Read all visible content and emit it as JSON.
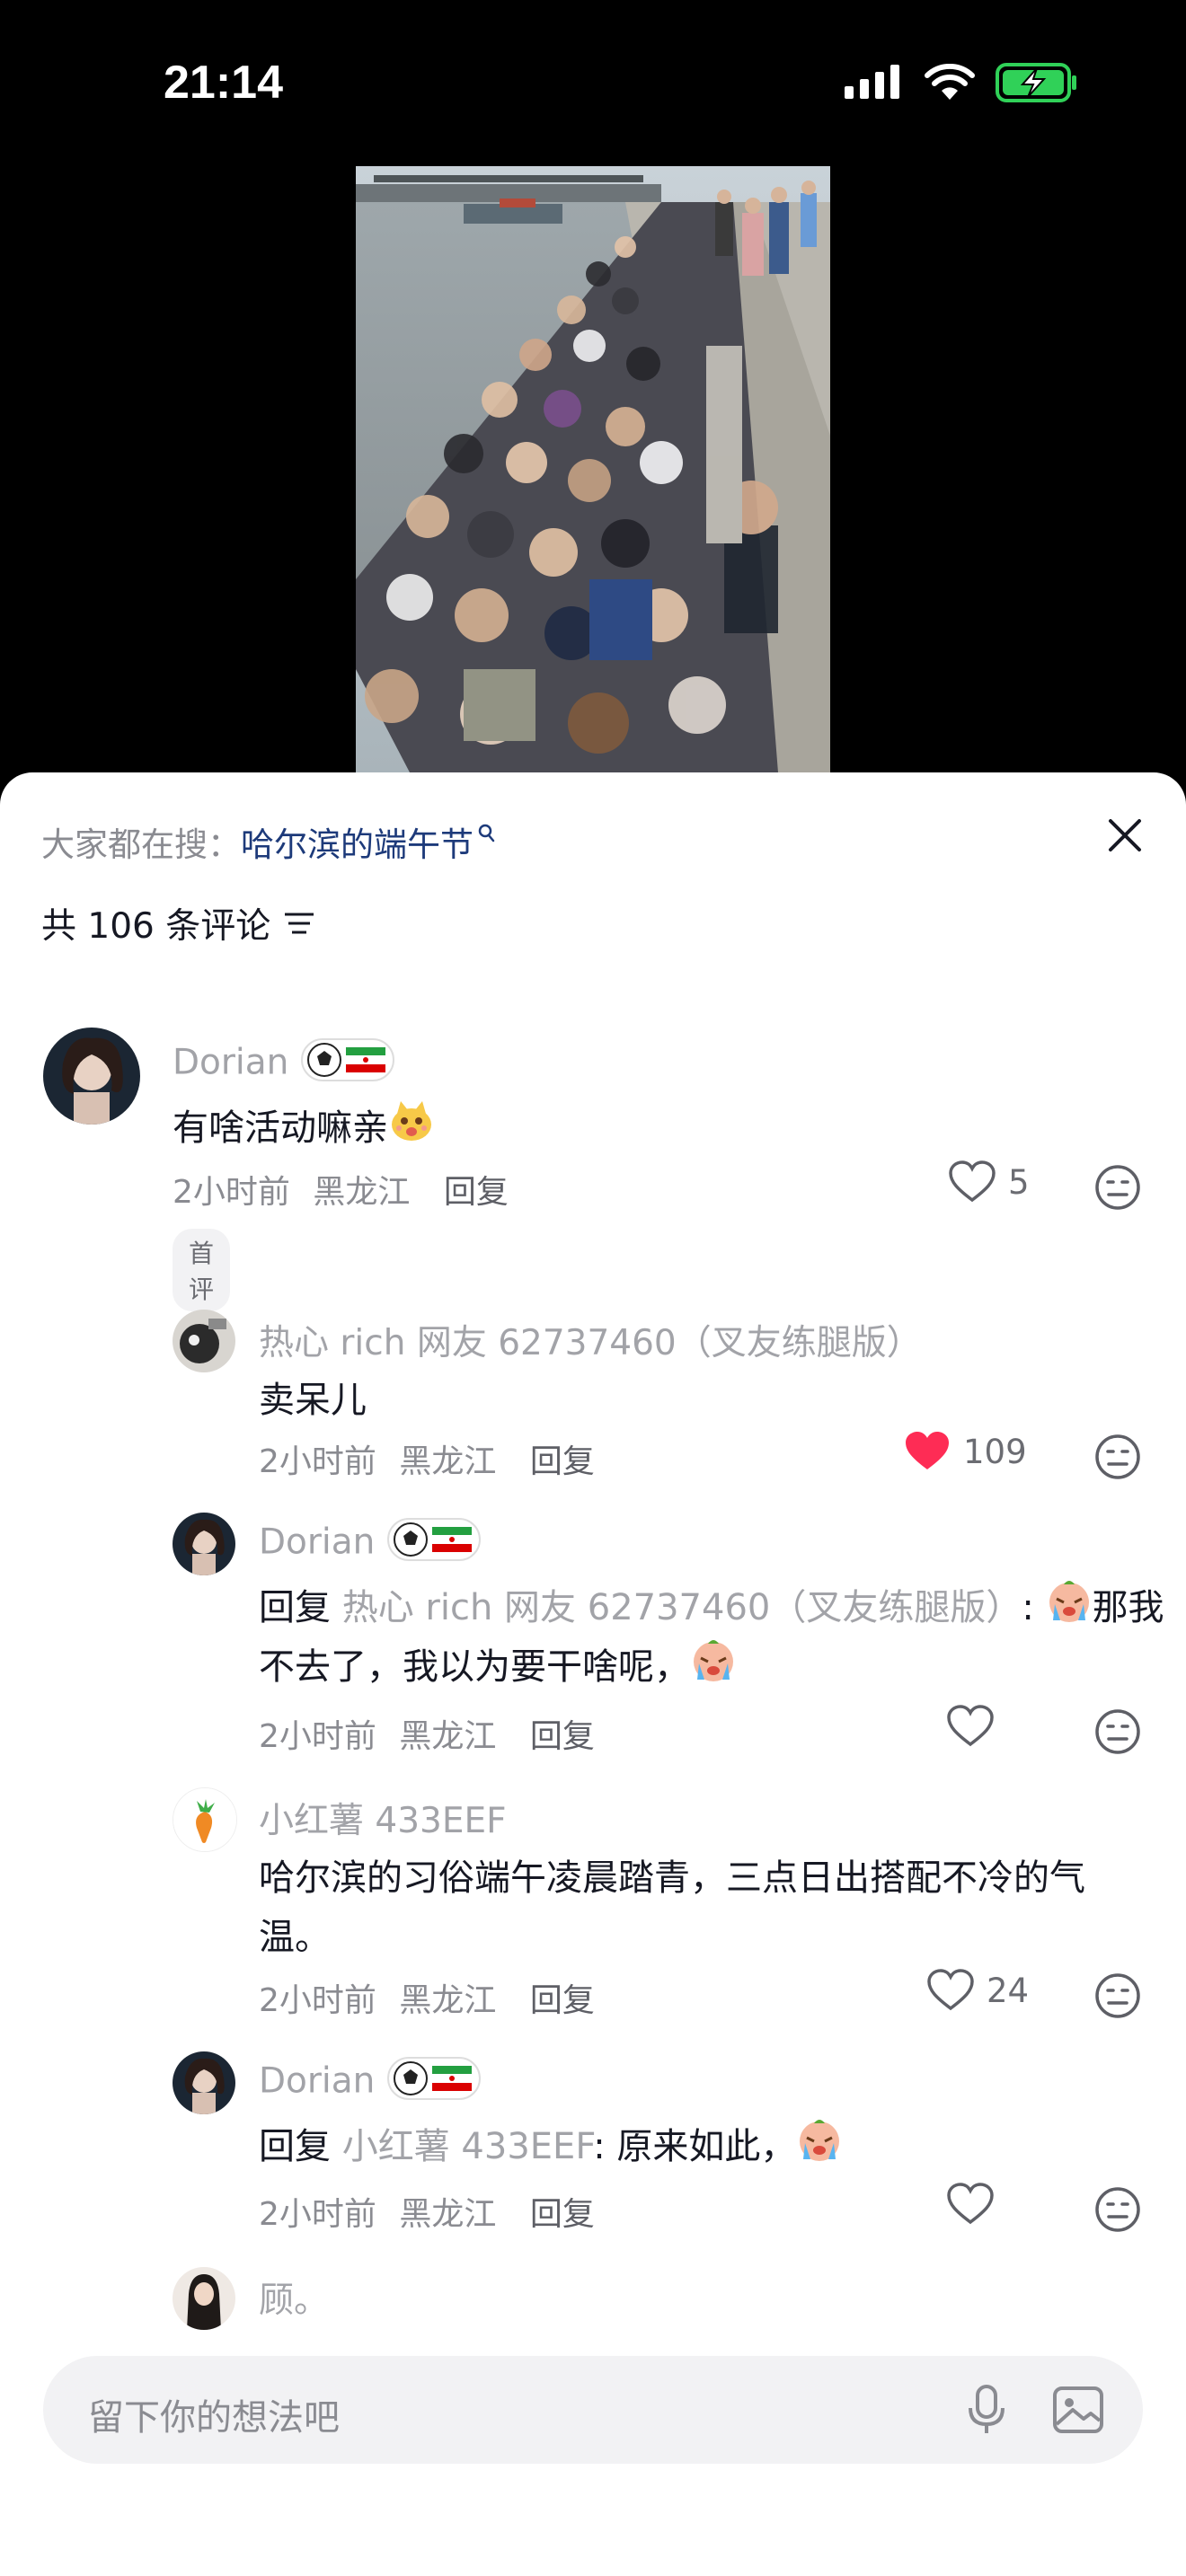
{
  "status": {
    "time": "21:14"
  },
  "header": {
    "search_prefix": "大家都在搜：",
    "search_term": "哈尔滨的端午节",
    "comment_count": "共 106 条评论"
  },
  "comments": [
    {
      "nick": "Dorian",
      "text": "有啥活动嘛亲",
      "time": "2小时前",
      "location": "黑龙江",
      "reply_label": "回复",
      "likes": "5",
      "tag": "首评"
    },
    {
      "nick": "热心 rich 网友 62737460（叉友练腿版）",
      "text": "卖呆儿",
      "time": "2小时前",
      "location": "黑龙江",
      "reply_label": "回复",
      "likes": "109"
    },
    {
      "nick": "Dorian",
      "reply_prefix": "回复",
      "reply_target": "热心 rich 网友 62737460（叉友练腿版）",
      "text_line1_tail": "那我",
      "text_line2": "不去了，我以为要干啥呢，",
      "time": "2小时前",
      "location": "黑龙江",
      "reply_label": "回复"
    },
    {
      "nick": "小红薯 433EEF",
      "text_line1": "哈尔滨的习俗端午凌晨踏青，三点日出搭配不冷的气",
      "text_line2": "温。",
      "time": "2小时前",
      "location": "黑龙江",
      "reply_label": "回复",
      "likes": "24"
    },
    {
      "nick": "Dorian",
      "reply_prefix": "回复",
      "reply_target": "小红薯 433EEF",
      "text_tail": ": 原来如此，",
      "time": "2小时前",
      "location": "黑龙江",
      "reply_label": "回复"
    },
    {
      "nick": "顾。"
    }
  ],
  "input": {
    "placeholder": "留下你的想法吧"
  },
  "colors": {
    "accent_like": "#fe2c55",
    "search_term": "#1d3a7a"
  }
}
